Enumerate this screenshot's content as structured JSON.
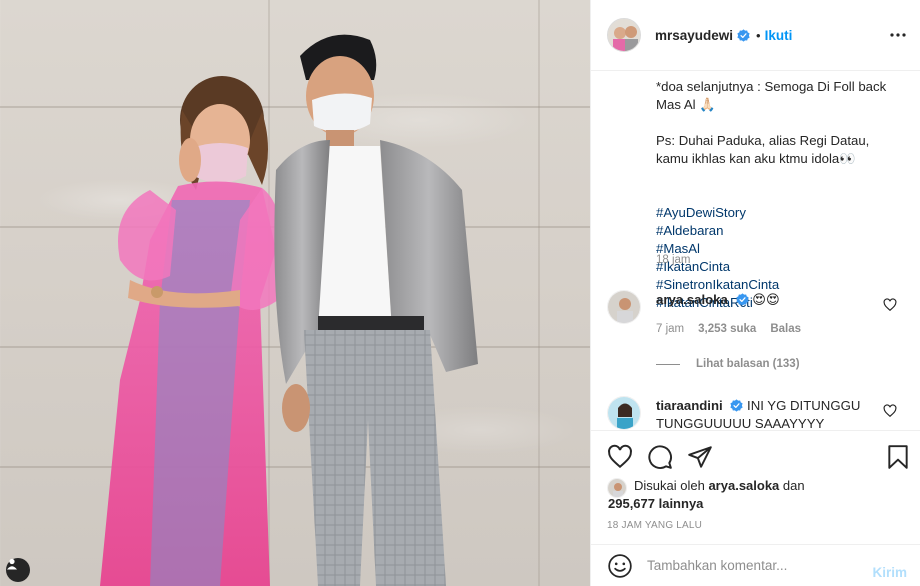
{
  "post": {
    "author": "mrsayudewi",
    "dot": "•",
    "follow_label": "Ikuti",
    "photo_alt": "Photo"
  },
  "caption": {
    "line1": "*doa selanjutnya : Semoga Di Foll back Mas Al 🙏🏻",
    "line2": "Ps: Duhai Paduka, alias Regi Datau, kamu ikhlas kan aku ktmu idola👀",
    "hashtags": [
      "#AyuDewiStory",
      "#Aldebaran",
      "#MasAl",
      "#IkatanCinta",
      "#SinetronIkatanCinta",
      "#IkatanCintaRcti"
    ],
    "time": "18 jam"
  },
  "comments": [
    {
      "user": "arya.saloka",
      "text": "😍😍",
      "time": "7 jam",
      "likes": "3,253 suka",
      "reply_label": "Balas"
    },
    {
      "user": "tiaraandini",
      "text": "INI YG DITUNGGU TUNGGUUUUU SAAAYYYY"
    }
  ],
  "view_replies": "Lihat balasan (133)",
  "likes": {
    "prefix": "Disukai oleh",
    "user": "arya.saloka",
    "and": "dan",
    "others": "295,677 lainnya"
  },
  "time_ago": "18 JAM YANG LALU",
  "add_comment": {
    "placeholder": "Tambahkan komentar...",
    "post_label": "Kirim"
  },
  "colors": {
    "accent": "#0095f6",
    "text": "#262626",
    "muted": "#8e8e8e",
    "hashtag": "#00376b",
    "verified": "#3897f0"
  },
  "icons": {
    "more": "more-horizontal-icon",
    "like": "heart-outline-icon",
    "comment": "comment-bubble-icon",
    "share": "paper-plane-icon",
    "save": "bookmark-icon",
    "emoji": "emoji-smile-icon",
    "verified": "verified-badge-icon",
    "user_tag": "user-tag-icon"
  }
}
